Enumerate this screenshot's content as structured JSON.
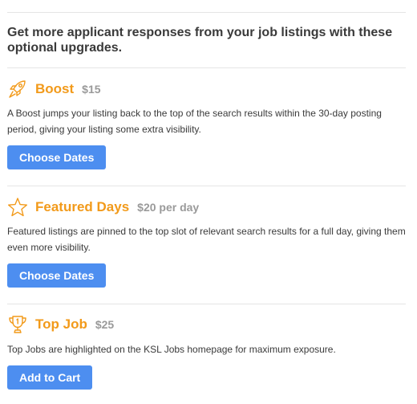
{
  "heading": "Get more applicant responses from your job listings with these optional upgrades.",
  "upgrades": [
    {
      "icon": "rocket-icon",
      "title": "Boost",
      "price": "$15",
      "description": "A Boost jumps your listing back to the top of the search results within the 30-day posting period, giving your listing some extra visibility.",
      "button_label": "Choose Dates"
    },
    {
      "icon": "star-icon",
      "title": "Featured Days",
      "price": "$20 per day",
      "description": "Featured listings are pinned to the top slot of relevant search results for a full day, giving them even more visibility.",
      "button_label": "Choose Dates"
    },
    {
      "icon": "trophy-icon",
      "title": "Top Job",
      "price": "$25",
      "description": "Top Jobs are highlighted on the KSL Jobs homepage for maximum exposure.",
      "button_label": "Add to Cart"
    }
  ],
  "colors": {
    "accent": "#f29a1a",
    "button": "#4d8ef0",
    "price": "#9a9a9a",
    "divider": "#e5e5e5"
  }
}
